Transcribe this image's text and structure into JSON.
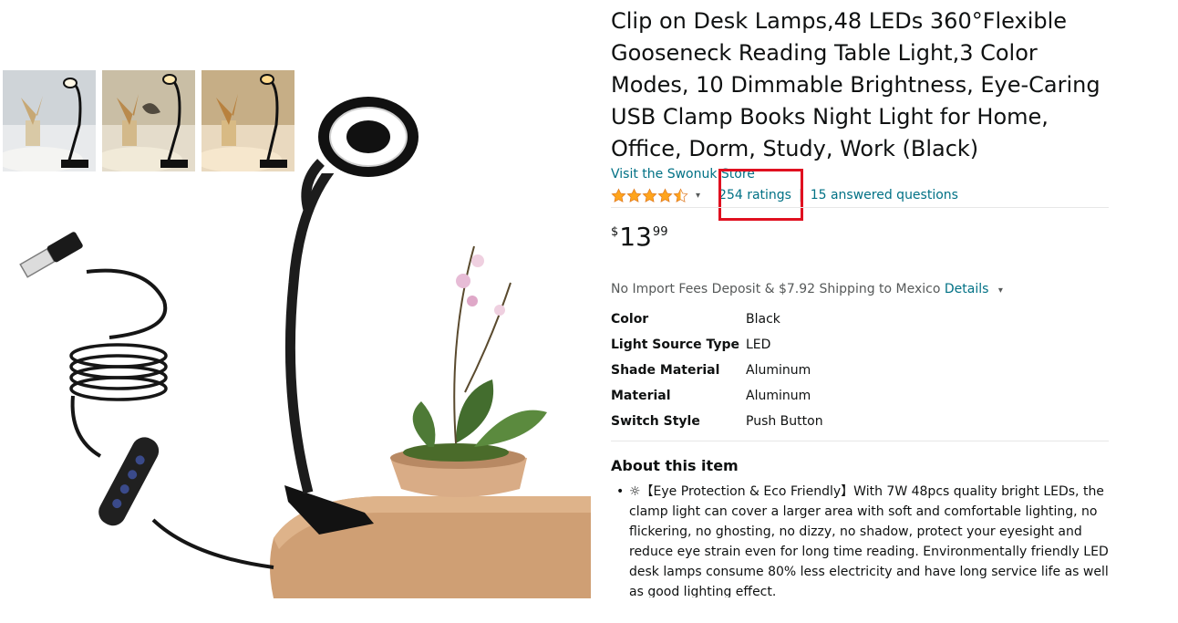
{
  "product": {
    "title": "Clip on Desk Lamps,48 LEDs 360°Flexible Gooseneck Reading Table Light,3 Color Modes, 10 Dimmable Brightness, Eye-Caring USB Clamp Books Night Light for Home, Office, Dorm, Study, Work (Black)",
    "store_link": "Visit the Swonuk Store",
    "rating": {
      "stars": 4.5,
      "ratings_count": "254 ratings",
      "separator": "|",
      "questions": "15 answered questions"
    },
    "price": {
      "symbol": "$",
      "whole": "13",
      "fraction": "99"
    },
    "shipping": {
      "text": "No Import Fees Deposit & $7.92 Shipping to Mexico",
      "details_link": "Details"
    },
    "attributes": [
      {
        "label": "Color",
        "value": "Black"
      },
      {
        "label": "Light Source Type",
        "value": "LED"
      },
      {
        "label": "Shade Material",
        "value": "Aluminum"
      },
      {
        "label": "Material",
        "value": "Aluminum"
      },
      {
        "label": "Switch Style",
        "value": "Push Button"
      }
    ],
    "about": {
      "heading": "About this item",
      "bullets": [
        "☼【Eye Protection & Eco Friendly】With 7W 48pcs quality bright LEDs, the clamp light can cover a larger area with soft and comfortable lighting, no flickering, no ghosting, no dizzy, no shadow, protect your eyesight and reduce eye strain even for long time reading. Environmentally friendly LED desk lamps consume 80% less electricity and have long service life as well as good lighting effect."
      ]
    }
  },
  "icons": {
    "star": "star-icon",
    "chevron": "chevron-down-icon"
  },
  "colors": {
    "link": "#007185",
    "star": "#FFA41C",
    "highlight": "#E01020",
    "text": "#0F1111",
    "muted": "#565959"
  }
}
